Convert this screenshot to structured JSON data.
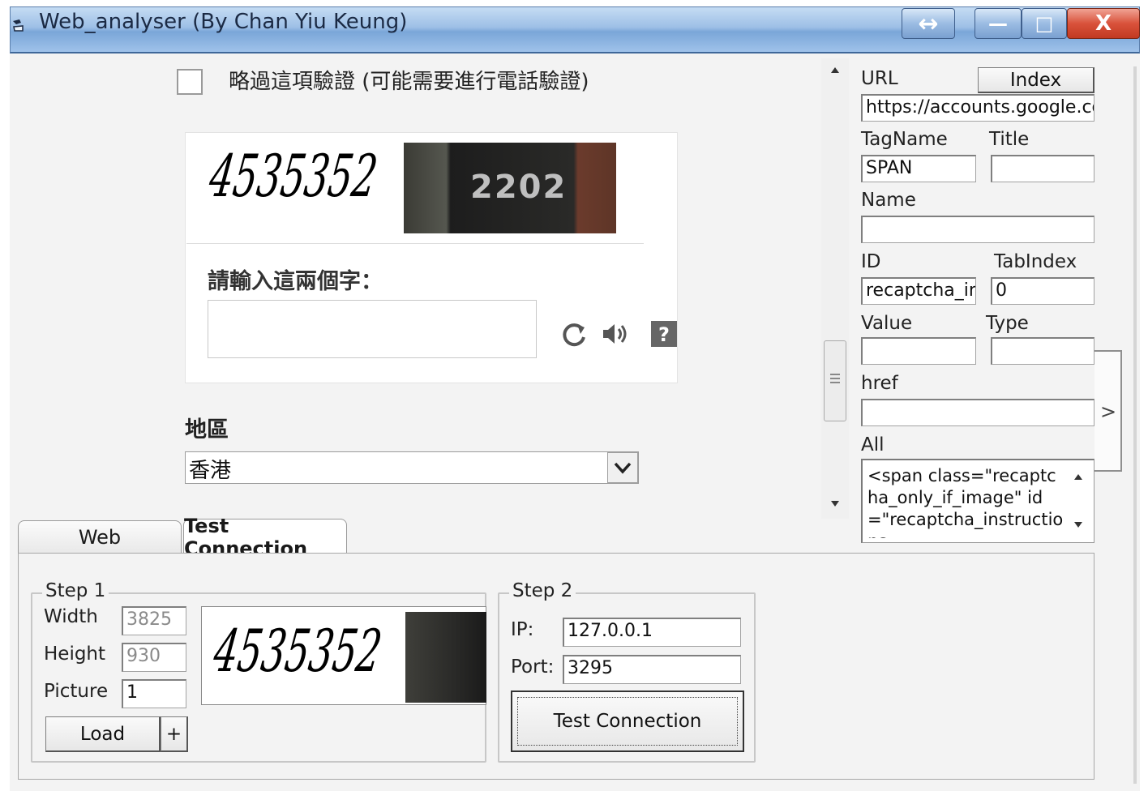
{
  "window": {
    "title": "Web_analyser (By Chan Yiu Keung)",
    "resize_icon": "↔",
    "minimize_icon": "—",
    "maximize_icon": "□",
    "close_icon": "X"
  },
  "web": {
    "skip_verification_label": "略過這項驗證 (可能需要進行電話驗證)",
    "captcha_text": "4535352",
    "house_number": "2202",
    "enter_words_label": "請輸入這兩個字：",
    "captcha_input_value": "",
    "refresh_icon": "refresh-icon",
    "audio_icon": "audio-icon",
    "help_icon": "help-icon",
    "region_label": "地區",
    "region_value": "香港"
  },
  "inspector": {
    "url_label": "URL",
    "index_button": "Index",
    "url_value": "https://accounts.google.com",
    "tagname_label": "TagName",
    "title_label": "Title",
    "tagname_value": "SPAN",
    "title_value": "",
    "name_label": "Name",
    "name_value": "",
    "id_label": "ID",
    "tabindex_label": "TabIndex",
    "id_value": "recaptcha_instructions",
    "tabindex_value": "0",
    "value_label": "Value",
    "type_label": "Type",
    "value_value": "",
    "type_value": "",
    "href_label": "href",
    "href_value": "",
    "all_label": "All",
    "all_value": "<span class=\"recaptcha_only_if_image\" id=\"recaptcha_instructions",
    "next_arrow": ">"
  },
  "tabs": [
    {
      "label": "Web",
      "active": false
    },
    {
      "label": "Test Connection",
      "active": true
    }
  ],
  "step1": {
    "title": "Step 1",
    "width_label": "Width",
    "width_value": "3825",
    "height_label": "Height",
    "height_value": "930",
    "picture_label": "Picture",
    "picture_value": "1",
    "load_button": "Load",
    "plus_button": "+",
    "preview_text": "4535352"
  },
  "step2": {
    "title": "Step 2",
    "ip_label": "IP:",
    "ip_value": "127.0.0.1",
    "port_label": "Port:",
    "port_value": "3295",
    "test_button": "Test Connection"
  }
}
